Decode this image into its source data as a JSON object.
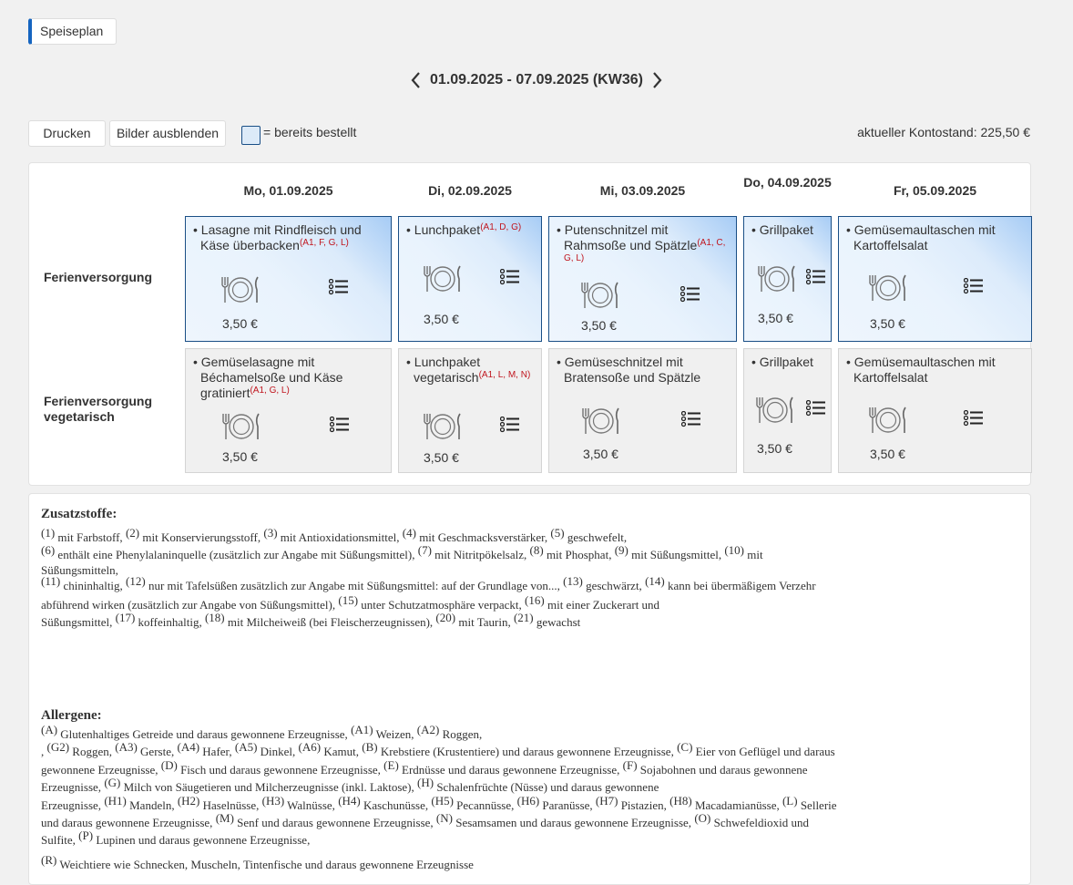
{
  "tab": {
    "label": "Speiseplan"
  },
  "week": {
    "label": "01.09.2025 - 07.09.2025 (KW36)"
  },
  "toolbar": {
    "print_label": "Drucken",
    "hide_images_label": "Bilder ausblenden",
    "legend_label": "= bereits bestellt",
    "balance": "aktueller Kontostand: 225,50 €"
  },
  "days": [
    {
      "label": "Mo, 01.09.2025"
    },
    {
      "label": "Di, 02.09.2025"
    },
    {
      "label": "Mi, 03.09.2025"
    },
    {
      "label": "Do, 04.09.2025"
    },
    {
      "label": "Fr, 05.09.2025"
    }
  ],
  "lines": [
    {
      "label": "Ferienversorgung"
    },
    {
      "label": "Ferienversorgung vegetarisch"
    }
  ],
  "meals": [
    [
      {
        "name": "Lasagne mit Rindfleisch und Käse überbacken",
        "allergens": "(A1, F, G, L)",
        "price": "3,50 €",
        "ordered": true
      },
      {
        "name": "Lunchpaket",
        "allergens": "(A1, D, G)",
        "price": "3,50 €",
        "ordered": true
      },
      {
        "name": "Putenschnitzel mit Rahmsoße und Spätzle",
        "allergens": "(A1, C, G, L)",
        "price": "3,50 €",
        "ordered": true
      },
      {
        "name": "Grillpaket",
        "allergens": "",
        "price": "3,50 €",
        "ordered": true
      },
      {
        "name": "Gemüsemaultaschen mit Kartoffelsalat",
        "allergens": "",
        "price": "3,50 €",
        "ordered": true
      }
    ],
    [
      {
        "name": "Gemüselasagne mit Béchamelsoße und Käse gratiniert",
        "allergens": "(A1, G, L)",
        "price": "3,50 €",
        "ordered": false
      },
      {
        "name": "Lunchpaket vegetarisch",
        "allergens": "(A1, L, M, N)",
        "price": "3,50 €",
        "ordered": false
      },
      {
        "name": "Gemüseschnitzel mit Bratensoße und Spätzle",
        "allergens": "",
        "price": "3,50 €",
        "ordered": false
      },
      {
        "name": "Grillpaket",
        "allergens": "",
        "price": "3,50 €",
        "ordered": false
      },
      {
        "name": "Gemüsemaultaschen mit Kartoffelsalat",
        "allergens": "",
        "price": "3,50 €",
        "ordered": false
      }
    ]
  ],
  "additives": {
    "title": "Zusatzstoffe:",
    "lines": [
      [
        [
          "(1)",
          " mit Farbstoff, "
        ],
        [
          "(2)",
          " mit Konservierungsstoff, "
        ],
        [
          "(3)",
          " mit Antioxidationsmittel, "
        ],
        [
          "(4)",
          " mit Geschmacksverstärker, "
        ],
        [
          "(5)",
          " geschwefelt,"
        ]
      ],
      [
        [
          "(6)",
          " enthält eine Phenylalaninquelle (zusätzlich zur Angabe mit Süßungsmittel), "
        ],
        [
          "(7)",
          " mit Nitritpökelsalz, "
        ],
        [
          "(8)",
          " mit Phosphat, "
        ],
        [
          "(9)",
          " mit Süßungsmittel, "
        ],
        [
          "(10)",
          " mit"
        ]
      ],
      [
        [
          "",
          "Süßungsmitteln,"
        ]
      ],
      [
        [
          "(11)",
          " chininhaltig, "
        ],
        [
          "(12)",
          " nur mit Tafelsüßen zusätzlich zur Angabe mit Süßungsmittel: auf der Grundlage von..., "
        ],
        [
          "(13)",
          " geschwärzt, "
        ],
        [
          "(14)",
          " kann bei übermäßigem Verzehr"
        ]
      ],
      [
        [
          "",
          "abführend wirken (zusätzlich zur Angabe von Süßungsmittel), "
        ],
        [
          "(15)",
          " unter Schutzatmosphäre verpackt, "
        ],
        [
          "(16)",
          " mit einer Zuckerart und"
        ]
      ],
      [
        [
          "",
          "Süßungsmittel, "
        ],
        [
          "(17)",
          " koffeinhaltig, "
        ],
        [
          "(18)",
          " mit Milcheiweiß (bei Fleischerzeugnissen), "
        ],
        [
          "(20)",
          " mit Taurin, "
        ],
        [
          "(21)",
          " gewachst"
        ]
      ]
    ]
  },
  "allergens": {
    "title": "Allergene:",
    "lines": [
      [
        [
          "(A)",
          " Glutenhaltiges Getreide und daraus gewonnene Erzeugnisse, "
        ],
        [
          "(A1)",
          " Weizen, "
        ],
        [
          "(A2)",
          " Roggen,"
        ]
      ],
      [
        [
          "",
          ", "
        ],
        [
          "(G2)",
          " Roggen, "
        ],
        [
          "(A3)",
          " Gerste, "
        ],
        [
          "(A4)",
          " Hafer, "
        ],
        [
          "(A5)",
          " Dinkel, "
        ],
        [
          "(A6)",
          " Kamut, "
        ],
        [
          "(B)",
          " Krebstiere (Krustentiere) und daraus gewonnene Erzeugnisse, "
        ],
        [
          "(C)",
          " Eier von Geflügel und daraus"
        ]
      ],
      [
        [
          "",
          "gewonnene Erzeugnisse, "
        ],
        [
          "(D)",
          " Fisch und daraus gewonnene Erzeugnisse, "
        ],
        [
          "(E)",
          " Erdnüsse und daraus gewonnene Erzeugnisse, "
        ],
        [
          "(F)",
          " Sojabohnen und daraus gewonnene"
        ]
      ],
      [
        [
          "",
          "Erzeugnisse, "
        ],
        [
          "(G)",
          " Milch von Säugetieren und Milcherzeugnisse (inkl. Laktose), "
        ],
        [
          "(H)",
          " Schalenfrüchte (Nüsse) und daraus gewonnene"
        ]
      ],
      [
        [
          "",
          "Erzeugnisse, "
        ],
        [
          "(H1)",
          " Mandeln, "
        ],
        [
          "(H2)",
          " Haselnüsse, "
        ],
        [
          "(H3)",
          " Walnüsse, "
        ],
        [
          "(H4)",
          " Kaschunüsse, "
        ],
        [
          "(H5)",
          " Pecannüsse, "
        ],
        [
          "(H6)",
          " Paranüsse, "
        ],
        [
          "(H7)",
          " Pistazien, "
        ],
        [
          "(H8)",
          " Macadamianüsse, "
        ],
        [
          "(L)",
          " Sellerie"
        ]
      ],
      [
        [
          "",
          "und daraus gewonnene Erzeugnisse, "
        ],
        [
          "(M)",
          " Senf und daraus gewonnene Erzeugnisse, "
        ],
        [
          "(N)",
          " Sesamsamen und daraus gewonnene Erzeugnisse, "
        ],
        [
          "(O)",
          " Schwefeldioxid und"
        ]
      ],
      [
        [
          "",
          "Sulfite, "
        ],
        [
          "(P)",
          " Lupinen und daraus gewonnene Erzeugnisse,"
        ]
      ],
      [
        [
          "",
          ""
        ]
      ],
      [
        [
          "(R)",
          " Weichtiere wie Schnecken, Muscheln, Tintenfische und daraus gewonnene Erzeugnisse"
        ]
      ]
    ]
  }
}
